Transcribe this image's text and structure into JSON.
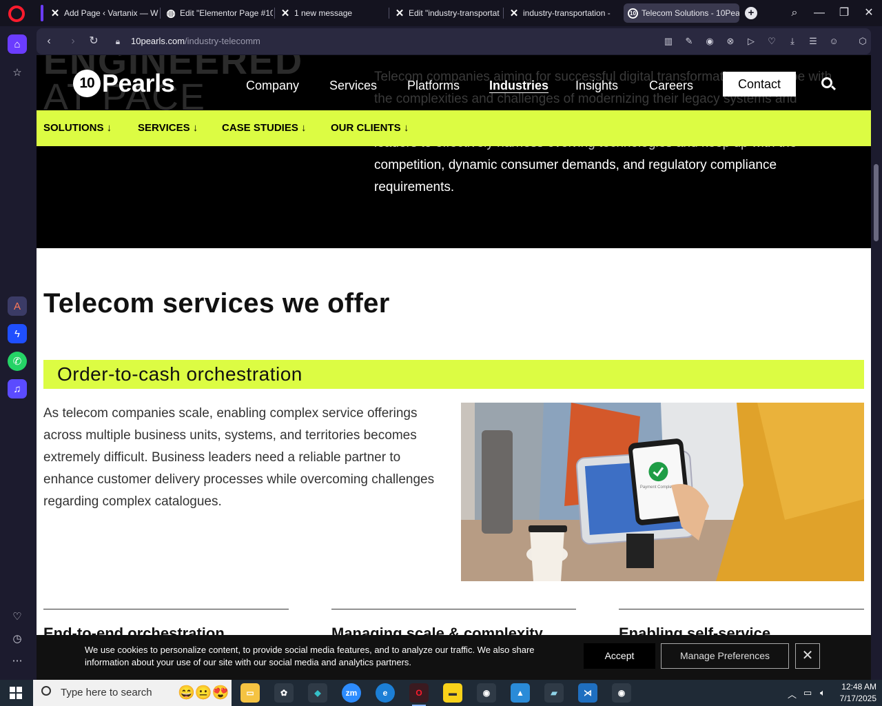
{
  "browser": {
    "tabs": [
      {
        "label": "Add Page ‹ Vartanix — W",
        "icon": "x-icon"
      },
      {
        "label": "Edit \"Elementor Page #10",
        "icon": "globe-icon"
      },
      {
        "label": "1 new message",
        "icon": "x-icon"
      },
      {
        "label": "Edit \"industry-transportat",
        "icon": "x-icon"
      },
      {
        "label": "industry-transportation - ",
        "icon": "x-icon"
      },
      {
        "label": "Telecom Solutions - 10Pea",
        "icon": "10pearls-icon",
        "active": true
      }
    ],
    "url_domain": "10pearls.com",
    "url_path": "/industry-telecomm"
  },
  "site": {
    "logo_mark": "10",
    "logo_text": "Pearls",
    "nav": [
      "Company",
      "Services",
      "Platforms",
      "Industries",
      "Insights",
      "Careers"
    ],
    "active_nav": "Industries",
    "contact_label": "Contact",
    "subnav": [
      "SOLUTIONS ↓",
      "SERVICES ↓",
      "CASE STUDIES ↓",
      "OUR CLIENTS ↓"
    ],
    "hero_ghost_1": "ENGINEERED",
    "hero_ghost_2": "AT PACE",
    "hero_line_1": "Telecom companies aiming for successful digital transformation must cope with",
    "hero_line_2": "the complexities and challenges of modernizing their legacy systems and",
    "hero_line_3": "leaders to effectively harness evolving technologies and keep up with the",
    "hero_line_4": "competition, dynamic consumer demands, and regulatory compliance",
    "hero_line_5": "requirements."
  },
  "section": {
    "heading": "Telecom services we offer",
    "service_title": "Order-to-cash orchestration",
    "service_body": "As telecom companies scale, enabling complex service offerings across multiple business units, systems, and territories becomes extremely difficult. Business leaders need a reliable partner to enhance customer delivery processes while overcoming challenges regarding complex catalogues.",
    "phone_caption": "Payment Completed",
    "columns": [
      "End-to-end orchestration",
      "Managing scale & complexity",
      "Enabling self-service"
    ]
  },
  "cookie": {
    "text": "We use cookies to personalize content, to provide social media features, and to analyze our traffic. We also share information about your use of our site with our social media and analytics partners.",
    "accept": "Accept",
    "manage": "Manage Preferences"
  },
  "taskbar": {
    "search_placeholder": "Type here to search",
    "time": "12:48 AM",
    "date": "7/17/2025"
  },
  "colors": {
    "accent_lime": "#dcfc43",
    "opera_red": "#ff1b2d",
    "opera_purple": "#6b3cff"
  }
}
